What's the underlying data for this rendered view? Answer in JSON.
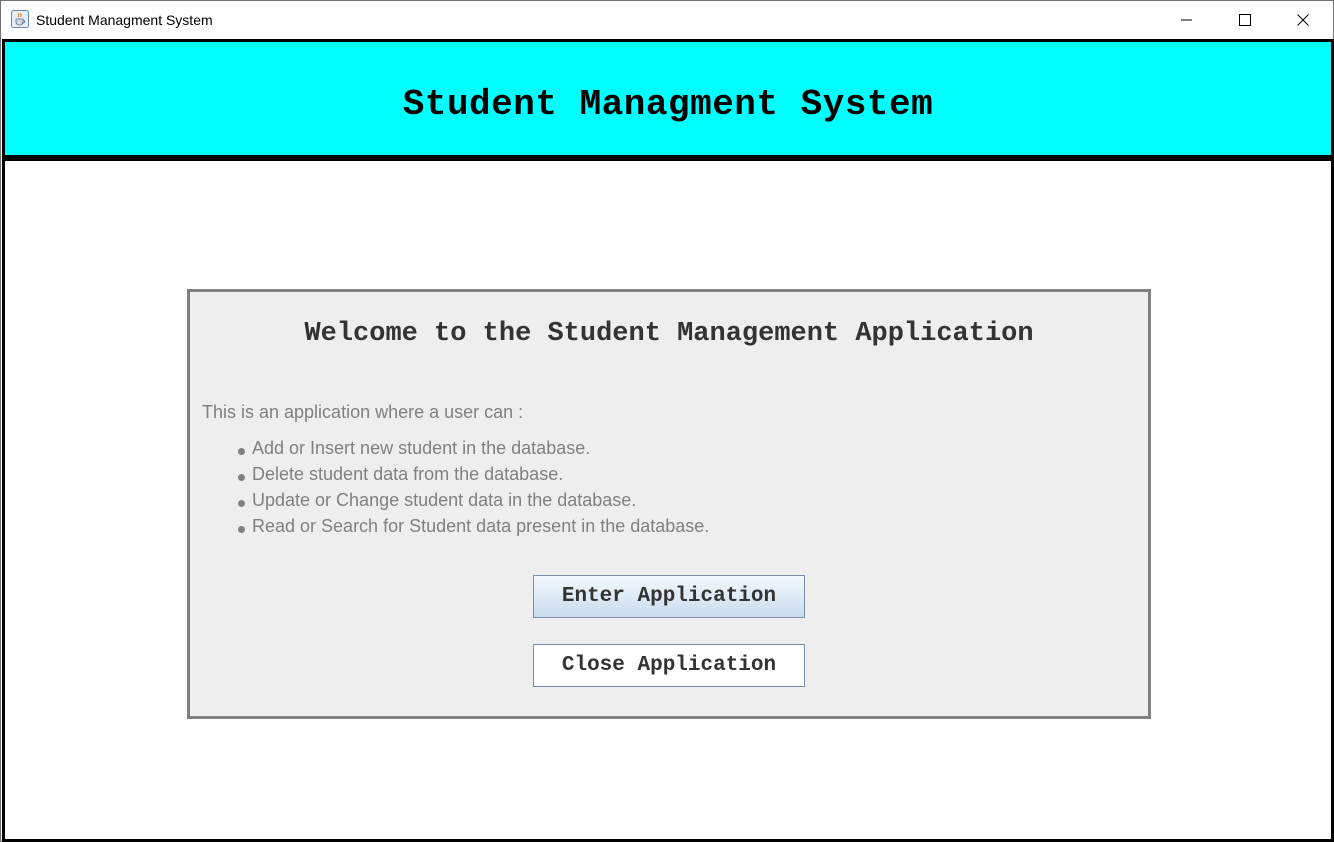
{
  "window": {
    "title": "Student Managment System",
    "icon": "java-coffee-cup-icon"
  },
  "header": {
    "title": "Student Managment System",
    "background": "#00ffff"
  },
  "welcome": {
    "heading": "Welcome to the Student Management Application",
    "intro": "This is an application where a user can :",
    "features": [
      "Add or Insert new student in the database.",
      "Delete student data from the database.",
      "Update or Change student data in the database.",
      "Read or Search for Student data present in the database."
    ]
  },
  "buttons": {
    "enter": "Enter Application",
    "close": "Close Application"
  },
  "colors": {
    "panel_bg": "#eeeeee",
    "panel_border": "#808080",
    "text_muted": "#808080"
  }
}
